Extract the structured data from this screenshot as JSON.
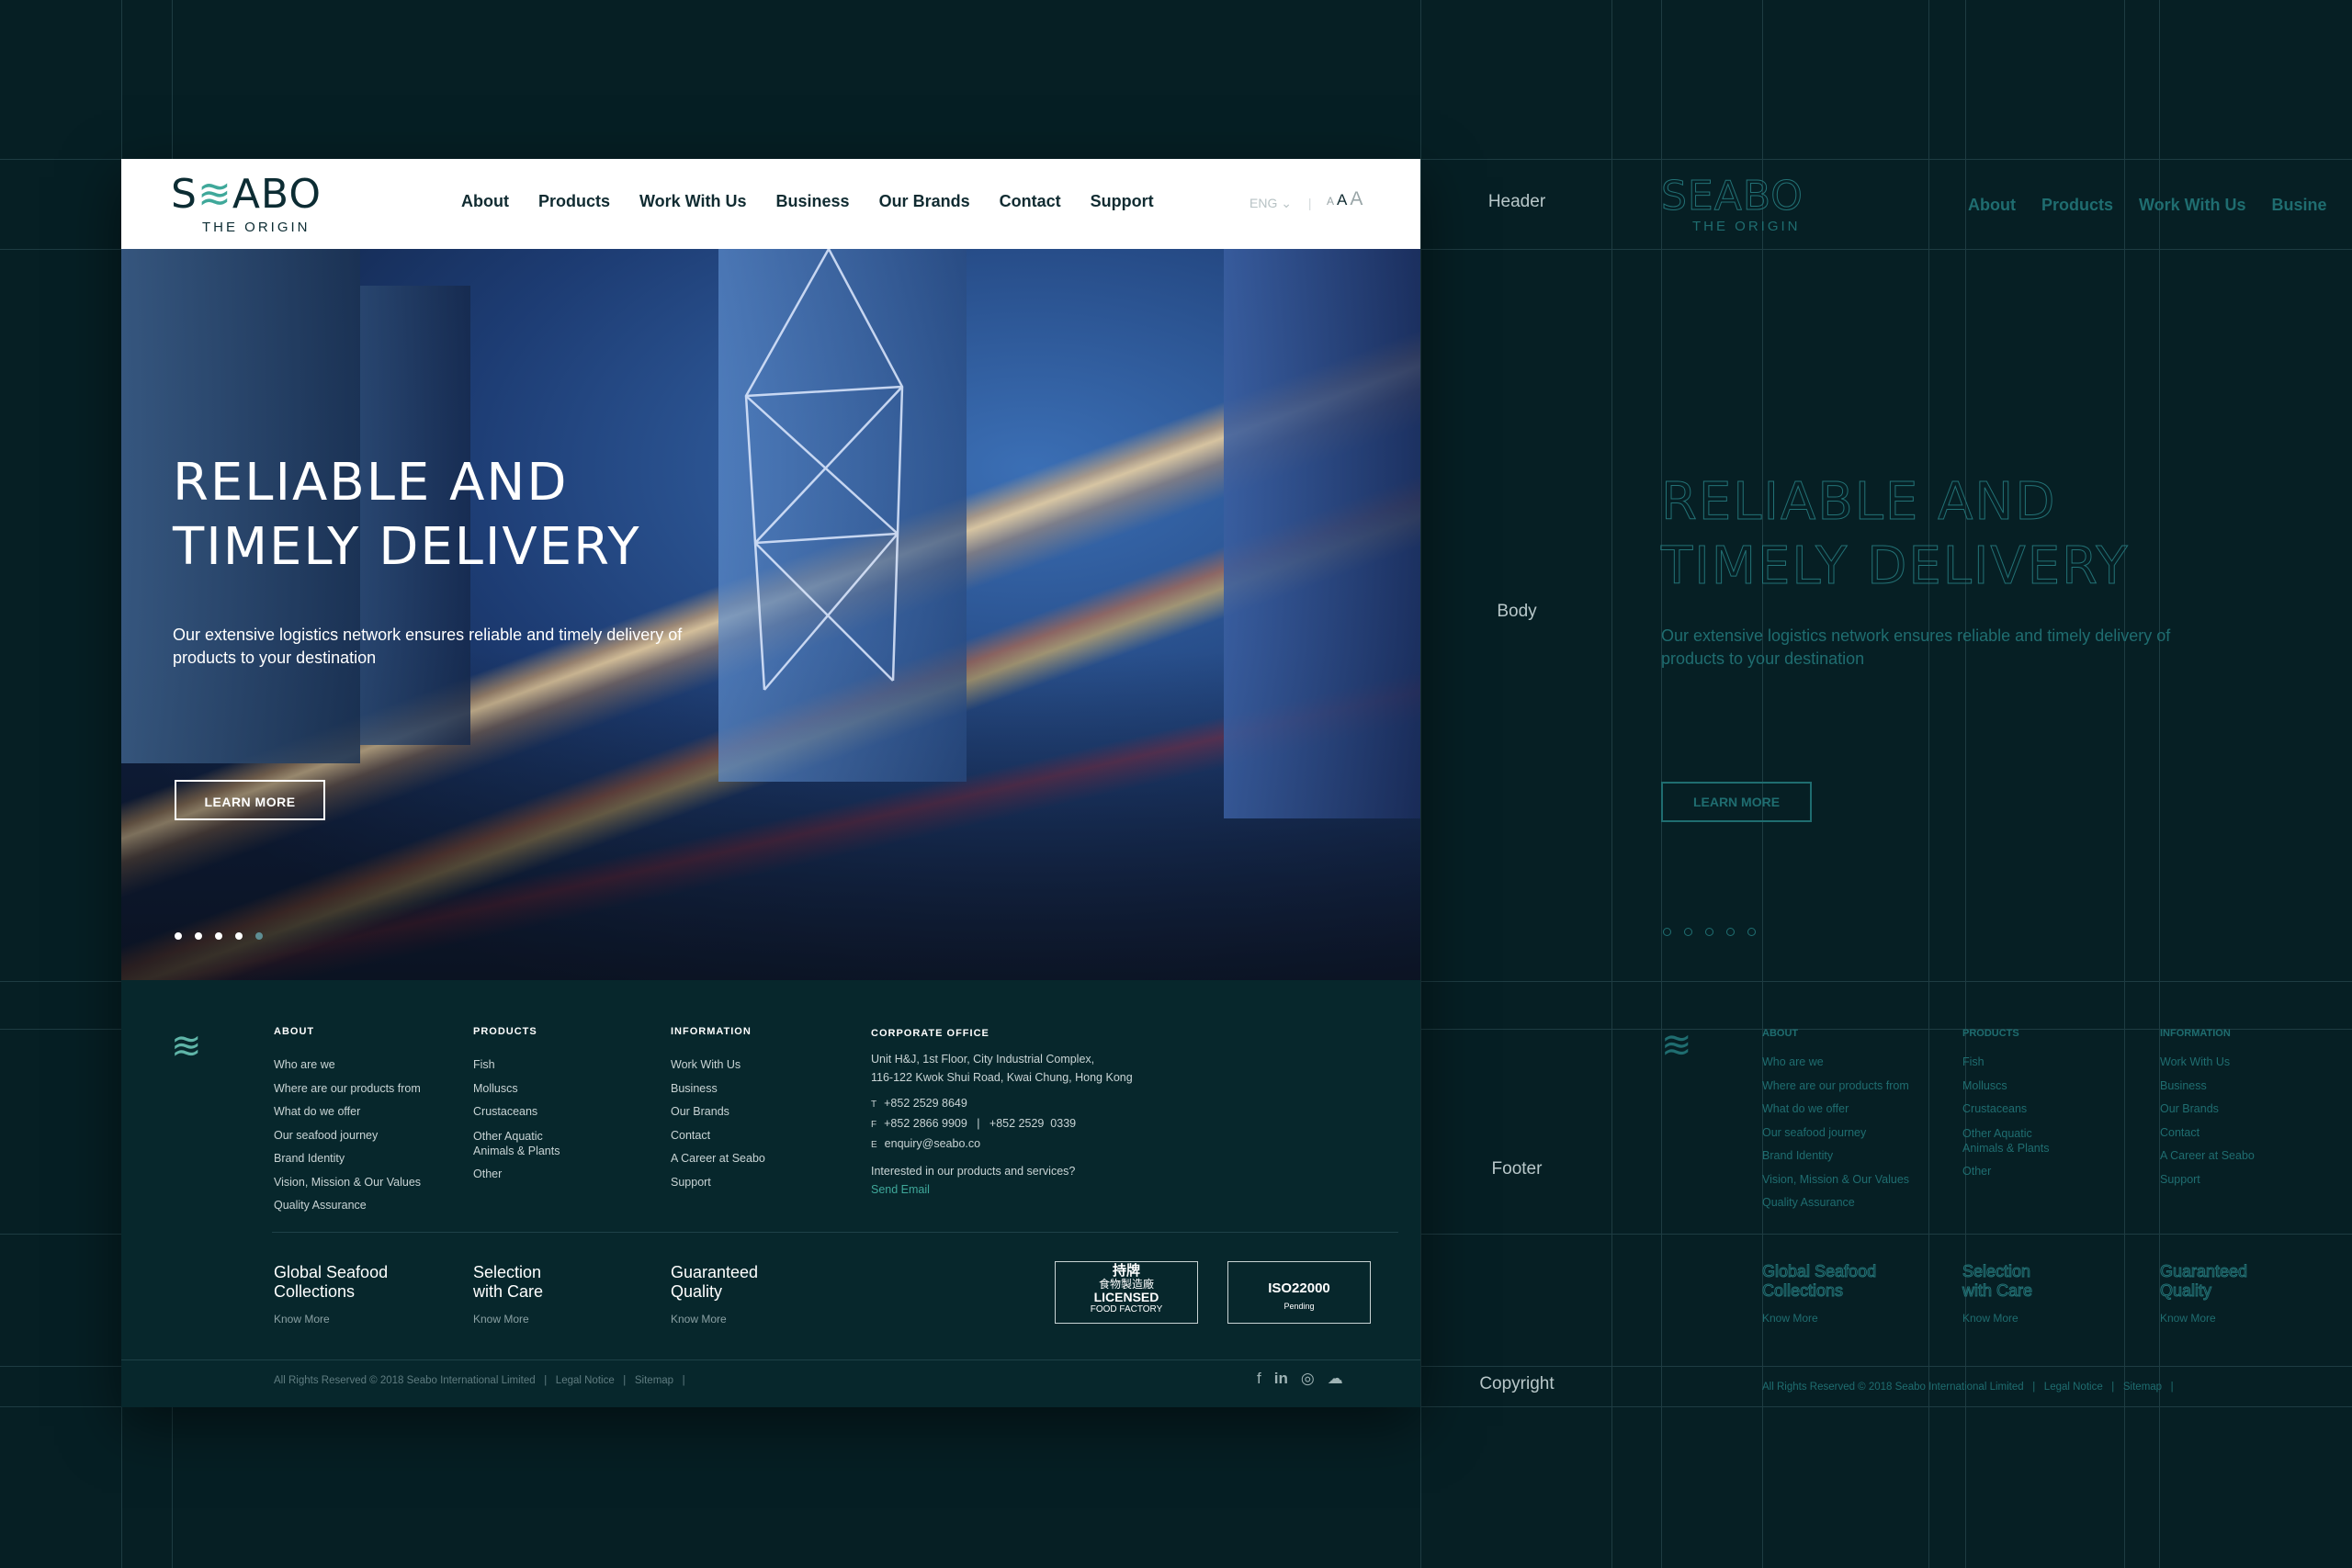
{
  "zones": {
    "header": "Header",
    "body": "Body",
    "footer": "Footer",
    "copyright": "Copyright"
  },
  "brand": {
    "name": "SEABO",
    "tagline": "THE ORIGIN"
  },
  "nav": [
    "About",
    "Products",
    "Work With Us",
    "Business",
    "Our Brands",
    "Contact",
    "Support"
  ],
  "nav_wireframe": [
    "About",
    "Products",
    "Work With Us",
    "Busine"
  ],
  "lang": "ENG",
  "font_size_controls": [
    "A",
    "A",
    "A"
  ],
  "hero": {
    "title_line1": "RELIABLE AND",
    "title_line2": "TIMELY DELIVERY",
    "subtitle": "Our extensive logistics network ensures reliable and timely delivery of products to your destination",
    "cta": "LEARN MORE",
    "slides": 5,
    "active_slide": 5
  },
  "footer": {
    "about": {
      "heading": "ABOUT",
      "items": [
        "Who are we",
        "Where are our products from",
        "What do we offer",
        "Our seafood journey",
        "Brand Identity",
        "Vision, Mission & Our Values",
        "Quality Assurance"
      ]
    },
    "products": {
      "heading": "PRODUCTS",
      "items": [
        "Fish",
        "Molluscs",
        "Crustaceans",
        "Other Aquatic Animals & Plants",
        "Other"
      ]
    },
    "information": {
      "heading": "INFORMATION",
      "items": [
        "Work With Us",
        "Business",
        "Our Brands",
        "Contact",
        "A Career at Seabo",
        "Support"
      ]
    },
    "corporate": {
      "heading": "CORPORATE OFFICE",
      "address1": "Unit H&J, 1st Floor, City Industrial Complex,",
      "address2": "116-122 Kwok Shui Road, Kwai Chung, Hong Kong",
      "tel_label": "T",
      "tel": "+852 2529 8649",
      "fax_label": "F",
      "fax": "+852 2866 9909   |   +852 2529  0339",
      "email_label": "E",
      "email": "enquiry@seabo.co",
      "interest": "Interested in our products and services?",
      "send": "Send Email"
    },
    "features": [
      {
        "title": "Global Seafood Collections",
        "link": "Know More"
      },
      {
        "title": "Selection with Care",
        "link": "Know More"
      },
      {
        "title": "Guaranteed Quality",
        "link": "Know More"
      }
    ],
    "badge1": {
      "line1": "持牌",
      "line2": "食物製造廠",
      "line3": "LICENSED",
      "line4": "FOOD FACTORY"
    },
    "badge2": {
      "title": "ISO22000",
      "sub": "Pending"
    },
    "copyright": "All Rights Reserved © 2018 Seabo International Limited   |   Legal Notice   |   Sitemap   |",
    "social_icons": [
      "facebook-icon",
      "linkedin-icon",
      "whatsapp-icon",
      "wechat-icon"
    ]
  },
  "colors": {
    "background": "#061f24",
    "footer": "#07272c",
    "accent": "#3fa89a",
    "wireframe": "#1f6d70"
  }
}
